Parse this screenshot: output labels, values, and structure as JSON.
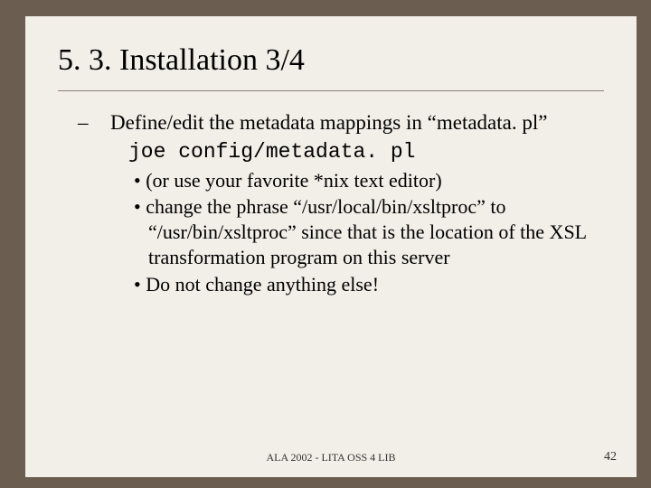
{
  "title": "5. 3. Installation 3/4",
  "main": {
    "dash_item": "Define/edit the metadata mappings in “metadata. pl”",
    "code_line": "joe config/metadata. pl",
    "bullets": [
      "(or use your favorite *nix text editor)",
      "change the phrase “/usr/local/bin/xsltproc” to “/usr/bin/xsltproc” since that is the location of the XSL transformation program on this server",
      "Do not change anything else!"
    ]
  },
  "footer": "ALA 2002 - LITA OSS 4 LIB",
  "page_number": "42"
}
